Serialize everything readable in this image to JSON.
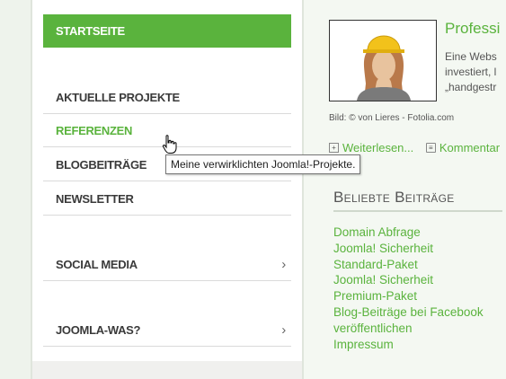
{
  "sidebar": {
    "home_label": "STARTSEITE",
    "items": [
      {
        "label": "AKTUELLE PROJEKTE",
        "active": false,
        "has_chevron": false
      },
      {
        "label": "REFERENZEN",
        "active": true,
        "has_chevron": false
      },
      {
        "label": "BLOGBEITRÄGE",
        "active": false,
        "has_chevron": false
      },
      {
        "label": "NEWSLETTER",
        "active": false,
        "has_chevron": false
      },
      {
        "label": "SOCIAL MEDIA",
        "active": false,
        "has_chevron": true
      },
      {
        "label": "JOOMLA-WAS?",
        "active": false,
        "has_chevron": true
      }
    ],
    "chevron": "›"
  },
  "tooltip": {
    "text": "Meine verwirklichten Joomla!-Projekte."
  },
  "post": {
    "title": "Professi",
    "excerpt_lines": [
      "Eine Webs",
      "investiert, l",
      "„handgestr"
    ],
    "photo_caption": "Bild: © von Lieres - Fotolia.com",
    "read_more": "Weiterlesen...",
    "comments": "Kommentar"
  },
  "popular": {
    "title": "Beliebte Beiträge",
    "items": [
      "Domain Abfrage",
      "Joomla! Sicherheit",
      "Standard-Paket",
      "Joomla! Sicherheit",
      "Premium-Paket",
      "Blog-Beiträge bei Facebook",
      "veröffentlichen",
      "Impressum"
    ]
  },
  "colors": {
    "accent": "#5ab33d",
    "nav_text": "#3a3a3a"
  },
  "icons": {
    "cursor": "hand-pointer-icon",
    "read_more": "plus-box-icon",
    "comments": "comment-icon"
  }
}
